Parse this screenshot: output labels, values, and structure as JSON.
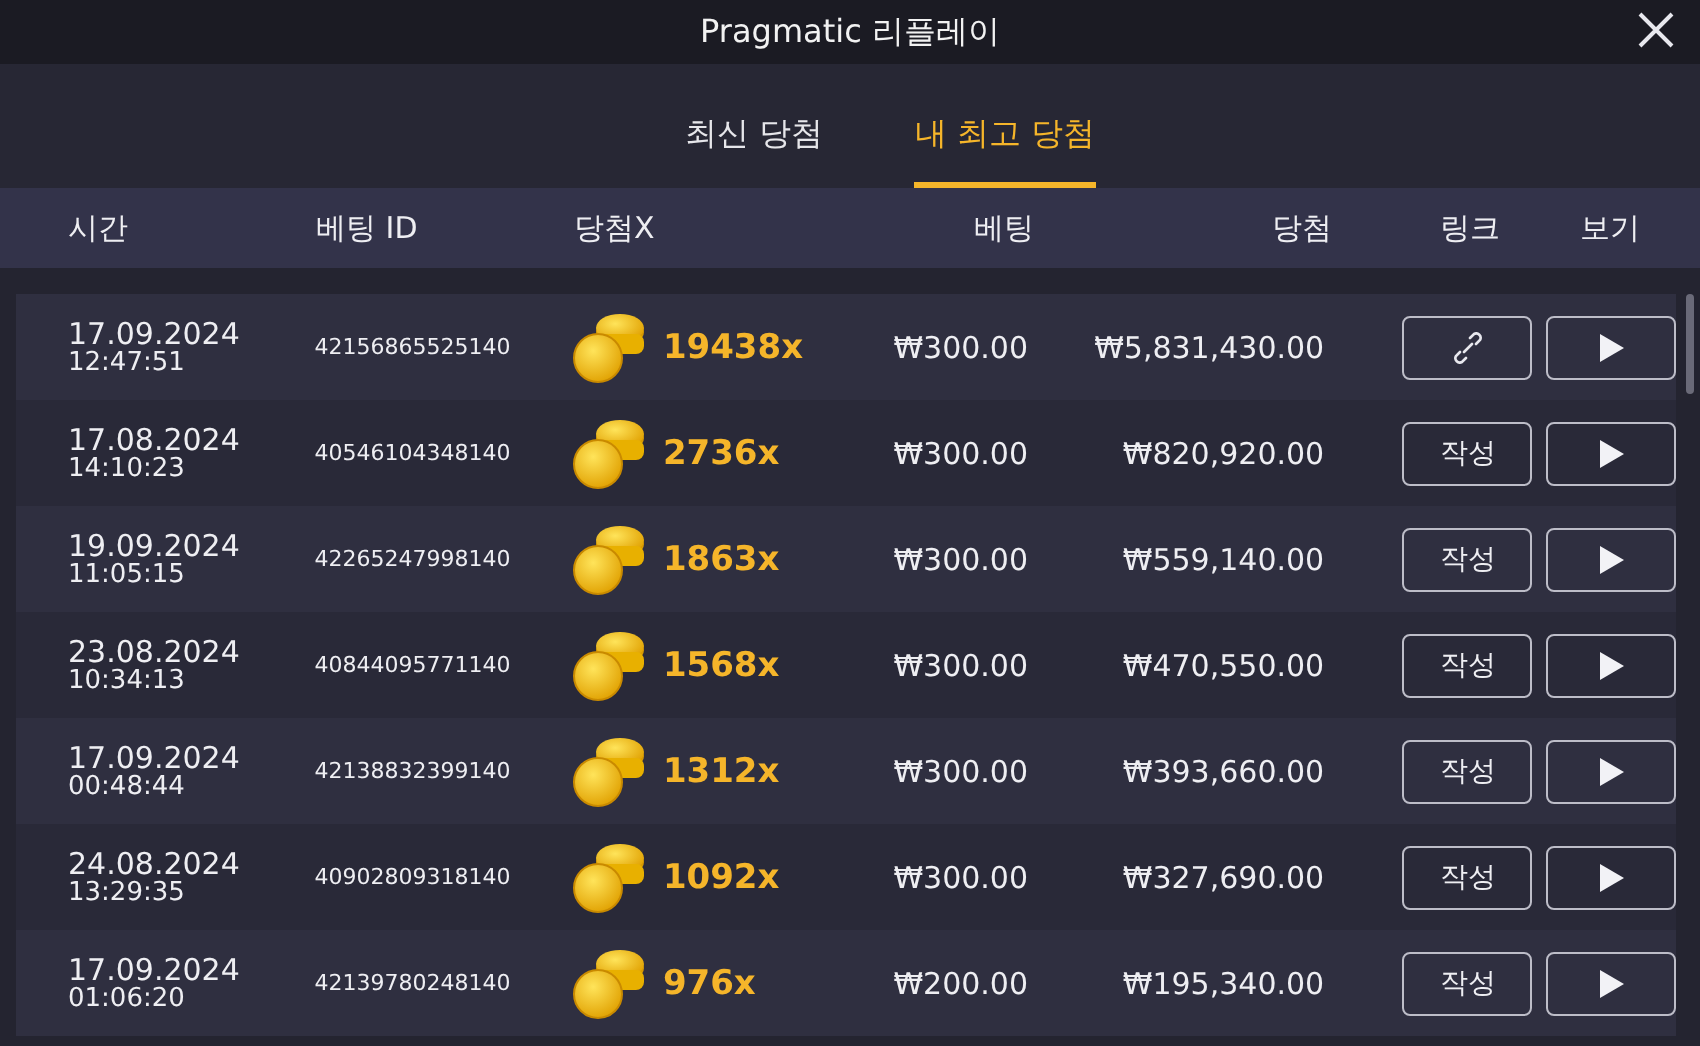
{
  "window": {
    "title": "Pragmatic 리플레이"
  },
  "tabs": [
    {
      "label": "최신 당첨",
      "selected": false
    },
    {
      "label": "내 최고 당첨",
      "selected": true
    }
  ],
  "table": {
    "columns": [
      "시간",
      "베팅 ID",
      "당첨X",
      "베팅",
      "당첨",
      "링크",
      "보기"
    ],
    "rows": [
      {
        "date": "17.09.2024",
        "time": "12:47:51",
        "bet_id": "42156865525140",
        "multiplier": "19438x",
        "bet": "₩300.00",
        "win": "₩5,831,430.00",
        "link": {
          "kind": "icon"
        }
      },
      {
        "date": "17.08.2024",
        "time": "14:10:23",
        "bet_id": "40546104348140",
        "multiplier": "2736x",
        "bet": "₩300.00",
        "win": "₩820,920.00",
        "link": {
          "kind": "text",
          "label": "작성"
        }
      },
      {
        "date": "19.09.2024",
        "time": "11:05:15",
        "bet_id": "42265247998140",
        "multiplier": "1863x",
        "bet": "₩300.00",
        "win": "₩559,140.00",
        "link": {
          "kind": "text",
          "label": "작성"
        }
      },
      {
        "date": "23.08.2024",
        "time": "10:34:13",
        "bet_id": "40844095771140",
        "multiplier": "1568x",
        "bet": "₩300.00",
        "win": "₩470,550.00",
        "link": {
          "kind": "text",
          "label": "작성"
        }
      },
      {
        "date": "17.09.2024",
        "time": "00:48:44",
        "bet_id": "42138832399140",
        "multiplier": "1312x",
        "bet": "₩300.00",
        "win": "₩393,660.00",
        "link": {
          "kind": "text",
          "label": "작성"
        }
      },
      {
        "date": "24.08.2024",
        "time": "13:29:35",
        "bet_id": "40902809318140",
        "multiplier": "1092x",
        "bet": "₩300.00",
        "win": "₩327,690.00",
        "link": {
          "kind": "text",
          "label": "작성"
        }
      },
      {
        "date": "17.09.2024",
        "time": "01:06:20",
        "bet_id": "42139780248140",
        "multiplier": "976x",
        "bet": "₩200.00",
        "win": "₩195,340.00",
        "link": {
          "kind": "text",
          "label": "작성"
        }
      }
    ]
  }
}
